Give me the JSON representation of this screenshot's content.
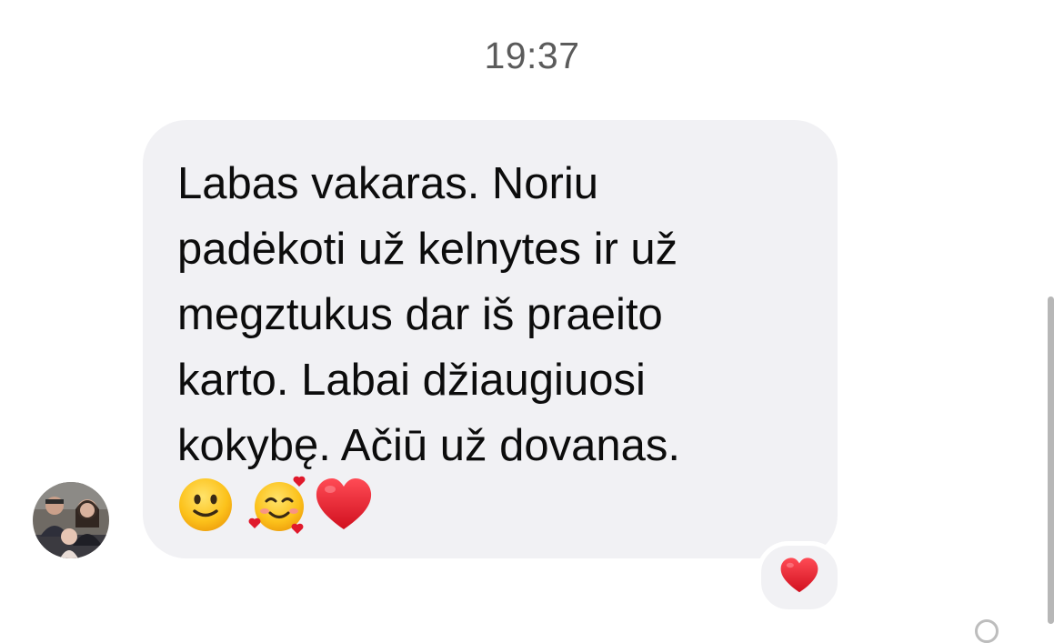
{
  "timestamp": "19:37",
  "message": {
    "lines": [
      "Labas vakaras. Noriu",
      "padėkoti už kelnytes ir už",
      "megztukus dar iš praeito",
      "karto. Labai džiaugiuosi",
      "kokybę. Ačiū už dovanas."
    ],
    "emojis": [
      "slightly-smiling-face-icon",
      "smiling-face-with-hearts-icon",
      "red-heart-icon"
    ]
  },
  "reaction": {
    "icon": "red-heart-icon"
  },
  "colors": {
    "bubble_background": "#f1f1f4",
    "text": "#0c0c0c",
    "timestamp": "#5b5b5b",
    "heart": "#e0192b"
  }
}
